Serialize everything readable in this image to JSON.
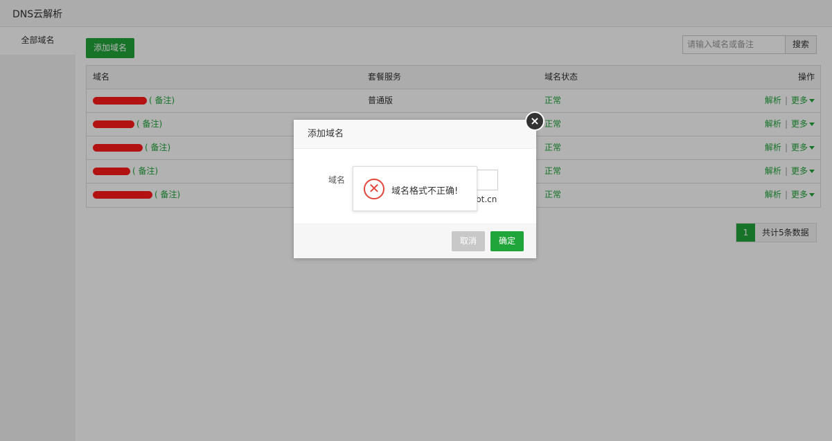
{
  "app": {
    "title": "DNS云解析"
  },
  "sidebar": {
    "items": [
      {
        "label": "全部域名"
      }
    ]
  },
  "toolbar": {
    "add_label": "添加域名"
  },
  "search": {
    "placeholder": "请输入域名或备注",
    "button_label": "搜索"
  },
  "table": {
    "headers": [
      "域名",
      "套餐服务",
      "域名状态",
      "操作"
    ],
    "rows": [
      {
        "note": "( 备注)",
        "plan": "普通版",
        "status": "正常",
        "action_resolve": "解析",
        "action_more": "更多"
      },
      {
        "note": "( 备注)",
        "plan": "",
        "status": "正常",
        "action_resolve": "解析",
        "action_more": "更多"
      },
      {
        "note": "( 备注)",
        "plan": "",
        "status": "正常",
        "action_resolve": "解析",
        "action_more": "更多"
      },
      {
        "note": "( 备注)",
        "plan": "",
        "status": "正常",
        "action_resolve": "解析",
        "action_more": "更多"
      },
      {
        "note": "( 备注)",
        "plan": "",
        "status": "正常",
        "action_resolve": "解析",
        "action_more": "更多"
      }
    ],
    "separator": "|"
  },
  "pagination": {
    "current_page": "1",
    "total_text": "共计5条数据"
  },
  "dialog": {
    "title": "添加域名",
    "domain_label": "域名",
    "hint_text": "bt.cn",
    "cancel_label": "取消",
    "ok_label": "确定",
    "close_icon": "close-icon"
  },
  "toast": {
    "message": "域名格式不正确!",
    "icon": "error-icon"
  },
  "colors": {
    "accent": "#20a53a",
    "error": "#e2463a",
    "redaction": "#ff1a1a"
  }
}
